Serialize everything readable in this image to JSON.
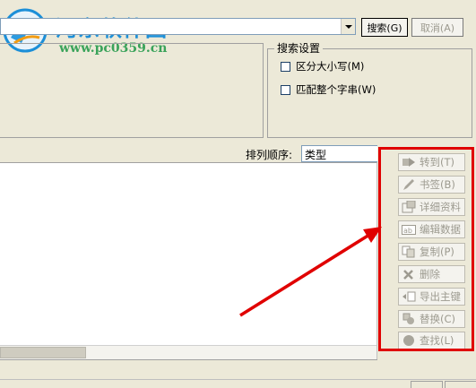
{
  "watermark": {
    "title": "河东软件园",
    "url": "www.pc0359.cn"
  },
  "search": {
    "search_button": "搜索(G)",
    "cancel_button": "取消(A)"
  },
  "search_settings": {
    "legend": "搜索设置",
    "options": [
      {
        "label": "区分大小写(M)",
        "checked": false
      },
      {
        "label": "匹配整个字串(W)",
        "checked": false
      }
    ]
  },
  "sort": {
    "label": "排列顺序:",
    "value": "类型"
  },
  "side_buttons": [
    {
      "label": "转到(T)",
      "icon": "goto-icon"
    },
    {
      "label": "书签(B)",
      "icon": "pencil-icon"
    },
    {
      "label": "详细资料",
      "icon": "details-icon"
    },
    {
      "label": "编辑数据",
      "icon": "edit-data-icon"
    },
    {
      "label": "复制(P)",
      "icon": "copy-icon"
    },
    {
      "label": "删除",
      "icon": "delete-icon"
    },
    {
      "label": "导出主键",
      "icon": "export-key-icon"
    },
    {
      "label": "替换(C)",
      "icon": "replace-icon"
    },
    {
      "label": "查找(L)",
      "icon": "find-icon"
    }
  ],
  "colors": {
    "highlight": "#e00000",
    "window_bg": "#ece9d8",
    "disabled_text": "#9c9a8f"
  }
}
